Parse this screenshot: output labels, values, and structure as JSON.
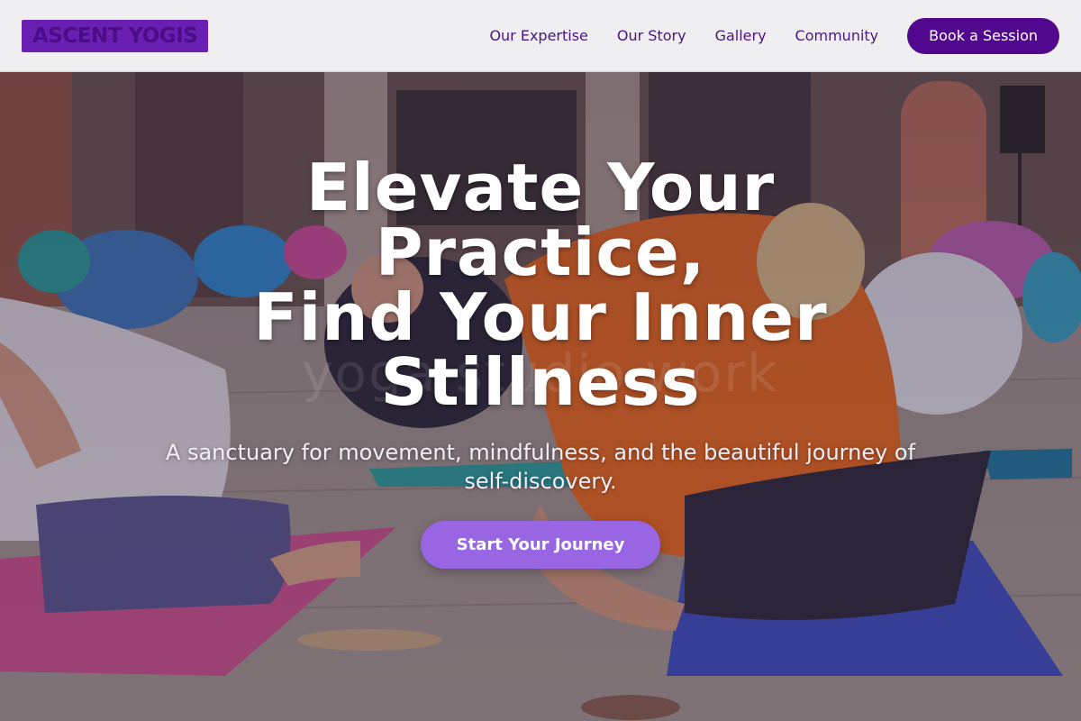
{
  "brand": {
    "logo_text": "ASCENT YOGIS"
  },
  "nav": {
    "links": [
      "Our Expertise",
      "Our Story",
      "Gallery",
      "Community"
    ],
    "cta_label": "Book a Session"
  },
  "hero": {
    "title_lines": [
      "Elevate Your",
      "Practice,",
      "Find Your Inner",
      "Stillness"
    ],
    "subtitle": "A sanctuary for movement, mindfulness, and the beautiful journey of self-discovery.",
    "cta_label": "Start Your Journey",
    "watermark_text": "yoga studio work",
    "background_image": "yoga-class-photo"
  },
  "colors": {
    "brand_purple": "#52088e",
    "logo_bg": "#6a1fb3",
    "nav_text": "#4a1580",
    "cta_purple": "#9966e3",
    "header_bg": "#efeef0"
  }
}
